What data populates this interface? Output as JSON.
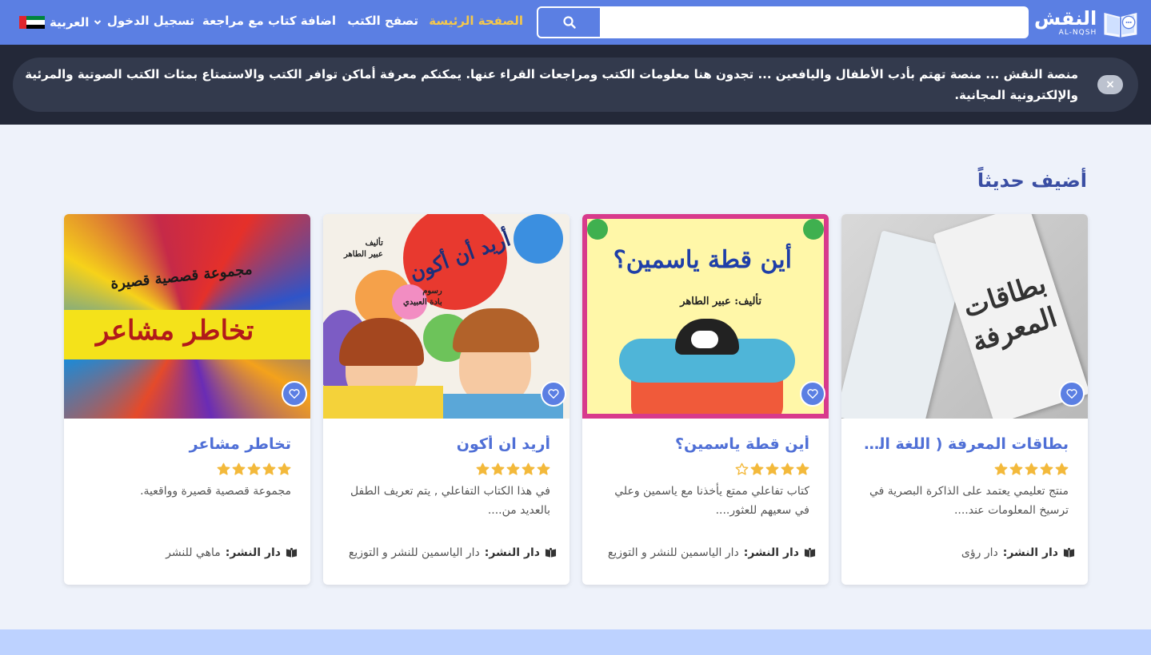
{
  "brand": {
    "name_ar": "النقش",
    "name_en": "AL-NQSH"
  },
  "search": {
    "placeholder": "",
    "value": ""
  },
  "nav": {
    "home": "الصفحة الرئيسة",
    "browse": "تصفح الكتب",
    "add_review": "اضافة كتاب مع مراجعة",
    "login": "تسجيل الدخول",
    "language": "العربية"
  },
  "announcement": {
    "text": "منصة النقش ... منصة تهتم بأدب الأطفال واليافعين ... تجدون هنا معلومات الكتب ومراجعات القراء عنها. يمكنكم معرفة أماكن توافر الكتب والاستمتاع بمئات الكتب الصوتية والمرئية والإلكترونية المجانية.",
    "close": "×"
  },
  "section": {
    "title": "أضيف حديثاً"
  },
  "labels": {
    "publisher": "دار النشر:"
  },
  "books": [
    {
      "title": "بطاقات المعرفة ( اللغة العربية )",
      "rating": 5,
      "description": "منتج تعليمي يعتمد على الذاكرة البصرية في ترسيخ المعلومات عند....",
      "publisher": "دار رؤى",
      "cover_text": [
        "بطاقات",
        "المعرفة"
      ]
    },
    {
      "title": "أين قطة ياسمين؟",
      "rating": 4,
      "description": "كتاب تفاعلي ممتع يأخذنا مع ياسمين وعلي في سعيهم للعثور....",
      "publisher": "دار الياسمين للنشر و التوزيع",
      "cover_text": [
        "أين قطة ياسمين؟",
        "تأليف: عبير الطاهر"
      ]
    },
    {
      "title": "أريد ان أكون",
      "rating": 5,
      "description": "في هذا الكتاب التفاعلي , يتم تعريف الطفل بالعديد من....",
      "publisher": "دار الياسمين للنشر و التوزيع",
      "cover_text": [
        "أريد أن أكون",
        "تأليف",
        "عبير الطاهر",
        "رسوم",
        "بادة العبيدي"
      ]
    },
    {
      "title": "تخاطر مشاعر",
      "rating": 5,
      "description": "مجموعة قصصية قصيرة وواقعية.",
      "publisher": "ماهي للنشر",
      "cover_text": [
        "مجموعة قصصية قصيرة",
        "تخاطر مشاعر"
      ]
    }
  ],
  "colors": {
    "navbar": "#5b7fe3",
    "active_link": "#f5c84b",
    "title": "#3a4ea3",
    "card_title": "#4f6fd6",
    "star": "#f3b93b"
  }
}
